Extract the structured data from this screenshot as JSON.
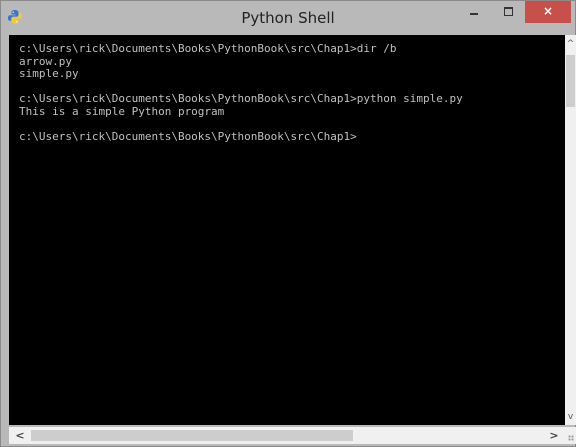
{
  "window": {
    "title": "Python Shell",
    "close_label": "×",
    "app_icon": "python-icon"
  },
  "console": {
    "text": "c:\\Users\\rick\\Documents\\Books\\PythonBook\\src\\Chap1>dir /b\narrow.py\nsimple.py\n\nc:\\Users\\rick\\Documents\\Books\\PythonBook\\src\\Chap1>python simple.py\nThis is a simple Python program\n\nc:\\Users\\rick\\Documents\\Books\\PythonBook\\src\\Chap1>"
  },
  "scrollbars": {
    "up": "^",
    "down": "v",
    "left": "<",
    "right": ">"
  },
  "colors": {
    "console_bg": "#000000",
    "console_text": "#c0c0c0",
    "close_button": "#c7514a",
    "titlebar": "#b9b9b9"
  }
}
